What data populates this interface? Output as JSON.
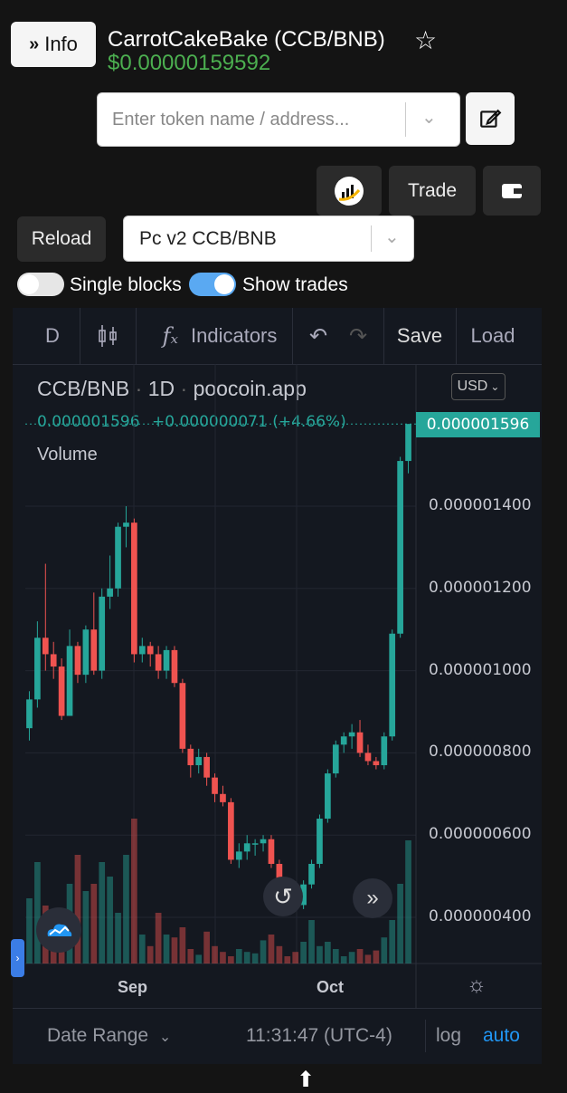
{
  "header": {
    "info_label": "Info",
    "title": "CarrotCakeBake (CCB/BNB)",
    "price": "$0.00000159592"
  },
  "search": {
    "placeholder": "Enter token name / address..."
  },
  "actions": {
    "trade_label": "Trade"
  },
  "controls": {
    "reload_label": "Reload",
    "pair_selected": "Pc v2 CCB/BNB",
    "single_blocks_label": "Single blocks",
    "single_blocks_on": false,
    "show_trades_label": "Show trades",
    "show_trades_on": true
  },
  "toolbar": {
    "interval": "D",
    "indicators_label": "Indicators",
    "save_label": "Save",
    "load_label": "Load"
  },
  "legend": {
    "symbol": "CCB/BNB",
    "interval": "1D",
    "source": "poocoin.app",
    "last_value": "0.000001596",
    "change": "+0.000000071 (+4.66%)",
    "volume_label": "Volume"
  },
  "currency": "USD",
  "axis": {
    "x_ticks": [
      "Sep",
      "Oct"
    ],
    "y_ticks": [
      "0.000001400",
      "0.000001200",
      "0.000001000",
      "0.000000800",
      "0.000000600",
      "0.000000400"
    ],
    "last_price_tag": "0.000001596"
  },
  "footer": {
    "date_range_label": "Date Range",
    "time": "11:31:47 (UTC-4)",
    "log_label": "log",
    "auto_label": "auto"
  },
  "colors": {
    "up": "#26a69a",
    "down": "#ef5350",
    "price_green": "#4caf50",
    "accent": "#2196f3"
  },
  "chart_data": {
    "type": "candlestick",
    "interval": "1D",
    "y_range": [
      3e-07,
      1.6e-06
    ],
    "candles": [
      [
        8.6e-07,
        9.5e-07,
        8.3e-07,
        9.3e-07
      ],
      [
        9.3e-07,
        1.12e-06,
        9.1e-07,
        1.08e-06
      ],
      [
        1.08e-06,
        1.26e-06,
        1e-06,
        1.04e-06
      ],
      [
        1.04e-06,
        1.07e-06,
        9.8e-07,
        1.01e-06
      ],
      [
        1.01e-06,
        1.03e-06,
        8.8e-07,
        8.9e-07
      ],
      [
        8.9e-07,
        1.1e-06,
        8.9e-07,
        1.06e-06
      ],
      [
        1.06e-06,
        1.07e-06,
        9.7e-07,
        9.9e-07
      ],
      [
        9.9e-07,
        1.11e-06,
        9.7e-07,
        1.1e-06
      ],
      [
        1.1e-06,
        1.19e-06,
        9.9e-07,
        1e-06
      ],
      [
        1e-06,
        1.2e-06,
        9.8e-07,
        1.18e-06
      ],
      [
        1.18e-06,
        1.28e-06,
        1.15e-06,
        1.2e-06
      ],
      [
        1.2e-06,
        1.36e-06,
        1.18e-06,
        1.35e-06
      ],
      [
        1.35e-06,
        1.4e-06,
        1.3e-06,
        1.36e-06
      ],
      [
        1.36e-06,
        1.37e-06,
        1.02e-06,
        1.04e-06
      ],
      [
        1.04e-06,
        1.08e-06,
        1.02e-06,
        1.06e-06
      ],
      [
        1.06e-06,
        1.07e-06,
        1.01e-06,
        1.04e-06
      ],
      [
        1.04e-06,
        1.06e-06,
        9.8e-07,
        1e-06
      ],
      [
        1e-06,
        1.06e-06,
        9.8e-07,
        1.05e-06
      ],
      [
        1.05e-06,
        1.06e-06,
        9.6e-07,
        9.7e-07
      ],
      [
        9.7e-07,
        9.8e-07,
        8e-07,
        8.1e-07
      ],
      [
        8.1e-07,
        8.2e-07,
        7.4e-07,
        7.7e-07
      ],
      [
        7.7e-07,
        8.1e-07,
        7.5e-07,
        7.9e-07
      ],
      [
        7.9e-07,
        8e-07,
        7.2e-07,
        7.4e-07
      ],
      [
        7.4e-07,
        7.5e-07,
        6.8e-07,
        7e-07
      ],
      [
        7e-07,
        7.2e-07,
        6.7e-07,
        6.8e-07
      ],
      [
        6.8e-07,
        6.9e-07,
        5.3e-07,
        5.4e-07
      ],
      [
        5.4e-07,
        5.8e-07,
        5.2e-07,
        5.6e-07
      ],
      [
        5.6e-07,
        6e-07,
        5.4e-07,
        5.8e-07
      ],
      [
        5.8e-07,
        5.9e-07,
        5.5e-07,
        5.8e-07
      ],
      [
        5.8e-07,
        6e-07,
        5.6e-07,
        5.9e-07
      ],
      [
        5.9e-07,
        6e-07,
        5.2e-07,
        5.3e-07
      ],
      [
        5.3e-07,
        5.4e-07,
        4.5e-07,
        4.7e-07
      ],
      [
        4.7e-07,
        4.9e-07,
        4.3e-07,
        4.4e-07
      ],
      [
        4.4e-07,
        4.6e-07,
        4.2e-07,
        4.3e-07
      ],
      [
        4.3e-07,
        4.9e-07,
        4.2e-07,
        4.8e-07
      ],
      [
        4.8e-07,
        5.4e-07,
        4.7e-07,
        5.3e-07
      ],
      [
        5.3e-07,
        6.5e-07,
        5.2e-07,
        6.4e-07
      ],
      [
        6.4e-07,
        7.6e-07,
        6.3e-07,
        7.5e-07
      ],
      [
        7.5e-07,
        8.3e-07,
        7.4e-07,
        8.2e-07
      ],
      [
        8.2e-07,
        8.5e-07,
        8e-07,
        8.4e-07
      ],
      [
        8.4e-07,
        8.7e-07,
        8.1e-07,
        8.5e-07
      ],
      [
        8.5e-07,
        8.8e-07,
        7.9e-07,
        8e-07
      ],
      [
        8e-07,
        8.2e-07,
        7.7e-07,
        7.8e-07
      ],
      [
        7.8e-07,
        7.9e-07,
        7.6e-07,
        7.7e-07
      ],
      [
        7.7e-07,
        8.5e-07,
        7.6e-07,
        8.4e-07
      ],
      [
        8.4e-07,
        1.1e-06,
        8.3e-07,
        1.09e-06
      ],
      [
        1.09e-06,
        1.52e-06,
        1.08e-06,
        1.51e-06
      ],
      [
        1.51e-06,
        1.6e-06,
        1.48e-06,
        1.6e-06
      ]
    ],
    "volume": [
      0.45,
      0.7,
      0.4,
      0.3,
      0.35,
      0.55,
      0.75,
      0.5,
      0.55,
      0.7,
      0.6,
      0.35,
      0.75,
      1.0,
      0.2,
      0.12,
      0.35,
      0.2,
      0.18,
      0.25,
      0.1,
      0.06,
      0.22,
      0.12,
      0.08,
      0.05,
      0.1,
      0.08,
      0.07,
      0.16,
      0.2,
      0.12,
      0.05,
      0.08,
      0.15,
      0.3,
      0.12,
      0.15,
      0.1,
      0.05,
      0.08,
      0.1,
      0.06,
      0.09,
      0.18,
      0.3,
      0.55,
      0.85
    ]
  }
}
